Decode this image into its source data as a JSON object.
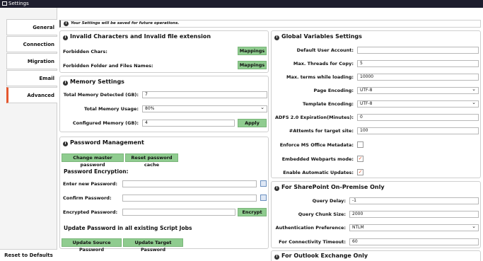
{
  "window": {
    "title": "Settings"
  },
  "sidebar": {
    "tabs": [
      {
        "label": "General"
      },
      {
        "label": "Connection"
      },
      {
        "label": "Migration"
      },
      {
        "label": "Email Notification"
      },
      {
        "label": "Advanced"
      }
    ],
    "active_tab": "Advanced",
    "reset_label": "Reset to Defaults"
  },
  "notice": "Your Settings will be saved for future operations.",
  "invalid_chars": {
    "title": "Invalid Characters and Invalid file extension",
    "forbidden_chars_label": "Forbidden Chars:",
    "forbidden_folders_label": "Forbidden Folder and Files Names:",
    "mappings_label": "Mappings"
  },
  "memory": {
    "title": "Memory Settings",
    "detected_label": "Total Memory Detected (GB):",
    "detected_value": "7",
    "usage_label": "Total Memory Usage:",
    "usage_value": "80%",
    "configured_label": "Configured Memory (GB):",
    "configured_value": "4",
    "apply_label": "Apply"
  },
  "password": {
    "title": "Password Management",
    "change_master_label": "Change master password",
    "reset_cache_label": "Reset password cache",
    "encryption_heading": "Password Encryption:",
    "new_label": "Enter new Password:",
    "new_value": "",
    "confirm_label": "Confirm Password:",
    "confirm_value": "",
    "encrypted_label": "Encrypted Password:",
    "encrypted_value": "",
    "encrypt_label": "Encrypt",
    "update_heading": "Update Password in all existing Script Jobs",
    "update_source_label": "Update Source Password",
    "update_target_label": "Update Target Password"
  },
  "global_vars": {
    "title": "Global Variables Settings",
    "default_user_label": "Default User Account:",
    "default_user_value": "",
    "max_threads_label": "Max. Threads for Copy:",
    "max_threads_value": "5",
    "max_terms_label": "Max. terms while loading:",
    "max_terms_value": "10000",
    "page_encoding_label": "Page Encoding:",
    "page_encoding_value": "UTF-8",
    "template_encoding_label": "Template Encoding:",
    "template_encoding_value": "UTF-8",
    "adfs_label": "ADFS 2.0 Expiration(Minutes):",
    "adfs_value": "0",
    "attempts_label": "#Attemts for target site:",
    "attempts_value": "100",
    "enforce_label": "Enforce MS Office Metadata:",
    "enforce_checked": false,
    "embedded_label": "Embedded Webparts mode:",
    "embedded_checked": true,
    "auto_updates_label": "Enable Automatic Updates:",
    "auto_updates_checked": true
  },
  "sharepoint": {
    "title": "For SharePoint On-Premise Only",
    "query_delay_label": "Query Delay:",
    "query_delay_value": "-1",
    "chunk_size_label": "Query Chunk Size:",
    "chunk_size_value": "2000",
    "auth_label": "Authentication Preference:",
    "auth_value": "NTLM",
    "timeout_label": "For Connectivity Timeout:",
    "timeout_value": "60"
  },
  "exchange": {
    "title": "For Outlook Exchange Only"
  },
  "colors": {
    "accent": "#e4572e",
    "button_green": "#8fcc8f",
    "titlebar": "#1e1e2e"
  },
  "icons": {
    "info": "info-icon",
    "copy": "copy-icon",
    "check": "check-icon",
    "window": "window-icon",
    "dropdown": "chevron-down-icon"
  }
}
